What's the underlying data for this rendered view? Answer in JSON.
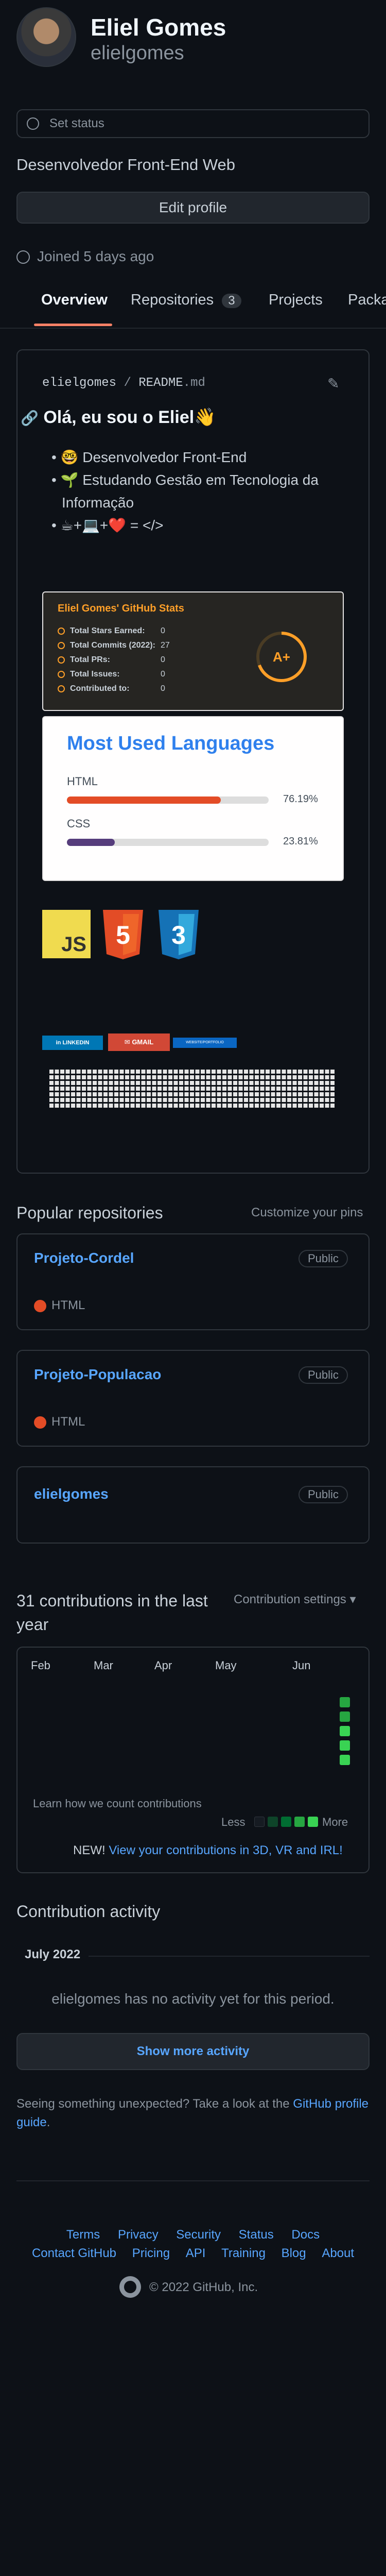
{
  "profile": {
    "name": "Eliel Gomes",
    "username": "elielgomes",
    "set_status": "Set status",
    "bio": "Desenvolvedor Front-End Web",
    "edit_profile": "Edit profile",
    "joined": "Joined 5 days ago"
  },
  "tabs": {
    "overview": "Overview",
    "repositories": "Repositories",
    "repositories_count": "3",
    "projects": "Projects",
    "packages": "Packa"
  },
  "readme": {
    "owner": "elielgomes",
    "separator": "/",
    "file": "README",
    "ext": ".md",
    "heading": "Olá, eu sou o Eliel",
    "heading_emoji": "👋",
    "items": [
      {
        "emoji": "🤓",
        "text": "Desenvolvedor Front-End"
      },
      {
        "emoji": "🌱",
        "text": "Estudando Gestão em Tecnologia da Informação"
      },
      {
        "emoji": "☕+💻+❤️",
        "text": "= </>"
      }
    ],
    "stats": {
      "title": "Eliel Gomes' GitHub Stats",
      "rows": [
        {
          "label": "Total Stars Earned:",
          "value": "0"
        },
        {
          "label": "Total Commits (2022):",
          "value": "27"
        },
        {
          "label": "Total PRs:",
          "value": "0"
        },
        {
          "label": "Total Issues:",
          "value": "0"
        },
        {
          "label": "Contributed to:",
          "value": "0"
        }
      ],
      "rank": "A+",
      "title_color": "#fe9f28"
    },
    "languages": {
      "title": "Most Used Languages",
      "items": [
        {
          "name": "HTML",
          "percent": "76.19%",
          "fraction": 0.7619,
          "color": "#e34c26"
        },
        {
          "name": "CSS",
          "percent": "23.81%",
          "fraction": 0.2381,
          "color": "#563d7c"
        }
      ]
    },
    "tech_icons": [
      "JS",
      "5",
      "3"
    ],
    "badges": {
      "linkedin": "LINKEDIN",
      "gmail": "GMAIL",
      "third": "WEBSITE/PORTFOLIO"
    }
  },
  "pinned": {
    "title": "Popular repositories",
    "customize": "Customize your pins",
    "repos": [
      {
        "name": "Projeto-Cordel",
        "visibility": "Public",
        "language": "HTML"
      },
      {
        "name": "Projeto-Populacao",
        "visibility": "Public",
        "language": "HTML"
      },
      {
        "name": "elielgomes",
        "visibility": "Public",
        "language": ""
      }
    ]
  },
  "contributions": {
    "title": "31 contributions in the last year",
    "settings": "Contribution settings",
    "months": [
      "Feb",
      "Mar",
      "Apr",
      "May",
      "Jun"
    ],
    "learn": "Learn how we count contributions",
    "less": "Less",
    "more": "More",
    "new_label": "NEW!",
    "new_link": "View your contributions in 3D, VR and IRL!"
  },
  "activity": {
    "title": "Contribution activity",
    "month": "July 2022",
    "empty": "elielgomes has no activity yet for this period.",
    "show_more": "Show more activity",
    "unexpected": "Seeing something unexpected? Take a look at the",
    "guide_link": "GitHub profile guide",
    "period": "."
  },
  "footer": {
    "row1": [
      "Terms",
      "Privacy",
      "Security",
      "Status",
      "Docs"
    ],
    "row2": [
      "Contact GitHub",
      "Pricing",
      "API",
      "Training",
      "Blog",
      "About"
    ],
    "copyright": "© 2022 GitHub, Inc."
  }
}
